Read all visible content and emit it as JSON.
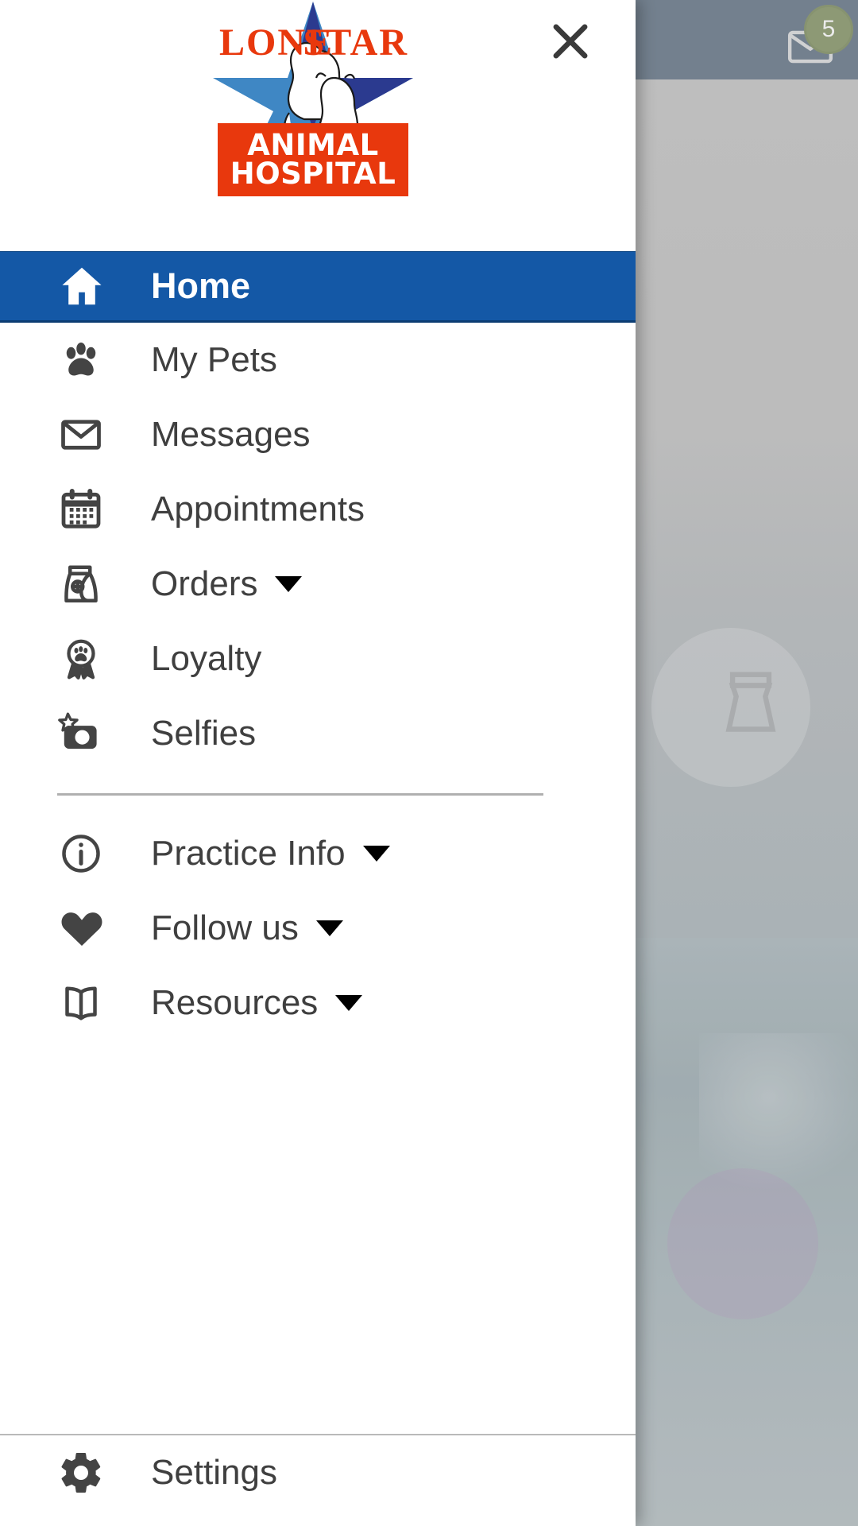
{
  "app": {
    "logo": {
      "word_left": "LONE",
      "word_right": "STAR",
      "banner_line1": "ANIMAL",
      "banner_line2": "HOSPITAL",
      "red": "#e8380d",
      "blue_dark": "#2b3a8f",
      "blue_light": "#3f87c4"
    },
    "close_icon_name": "close-icon",
    "accent_blue": "#1458a6"
  },
  "background": {
    "unread_badge": "5",
    "mail_icon": "mail-icon"
  },
  "drawer": {
    "primary_items": [
      {
        "label": "Home",
        "icon": "home-icon",
        "active": true,
        "has_caret": false
      },
      {
        "label": "My Pets",
        "icon": "paw-icon",
        "active": false,
        "has_caret": false
      },
      {
        "label": "Messages",
        "icon": "envelope-icon",
        "active": false,
        "has_caret": false
      },
      {
        "label": "Appointments",
        "icon": "calendar-icon",
        "active": false,
        "has_caret": false
      },
      {
        "label": "Orders",
        "icon": "food-bag-icon",
        "active": false,
        "has_caret": true
      },
      {
        "label": "Loyalty",
        "icon": "award-paw-icon",
        "active": false,
        "has_caret": false
      },
      {
        "label": "Selfies",
        "icon": "camera-star-icon",
        "active": false,
        "has_caret": false
      }
    ],
    "secondary_items": [
      {
        "label": "Practice Info",
        "icon": "info-circle-icon",
        "has_caret": true
      },
      {
        "label": "Follow us",
        "icon": "heart-icon",
        "has_caret": true
      },
      {
        "label": "Resources",
        "icon": "book-icon",
        "has_caret": true
      }
    ],
    "bottom_items": [
      {
        "label": "Settings",
        "icon": "gear-icon",
        "has_caret": false
      }
    ]
  }
}
